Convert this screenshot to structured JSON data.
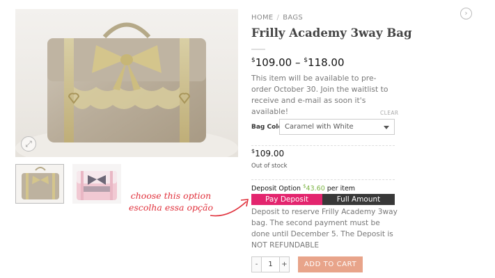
{
  "breadcrumb": {
    "home": "HOME",
    "separator": "/",
    "category": "BAGS"
  },
  "product": {
    "title": "Frilly Academy 3way Bag",
    "price_min": "109.00",
    "price_max": "118.00",
    "currency_symbol": "$",
    "price_dash": "–",
    "notice": "This item will be available to pre-order October 30. Join the waitlist to receive and e-mail as soon it's available!"
  },
  "variation": {
    "clear_label": "CLEAR",
    "color_label": "Bag Color",
    "color_value": "Caramel with White",
    "price": "109.00",
    "stock": "Out of stock"
  },
  "deposit": {
    "label": "Deposit Option",
    "amount": "43.60",
    "suffix": "per item",
    "pay_deposit_label": "Pay Deposit",
    "full_amount_label": "Full Amount",
    "description": "Deposit to reserve Frilly Academy 3way bag. The second payment must be done until December 5. The Deposit is NOT REFUNDABLE"
  },
  "annotation": {
    "line1": "choose this option",
    "line2": "escolha essa opção"
  },
  "cart": {
    "minus": "-",
    "quantity": "1",
    "plus": "+",
    "add_to_cart": "ADD TO CART"
  },
  "icons": {
    "zoom": "zoom-icon",
    "next": "chevron-right-icon"
  },
  "colors": {
    "pay_deposit": "#e3256e",
    "full_amount": "#383838",
    "add_to_cart": "#e8a48a",
    "deposit_amount": "#7bb342",
    "annotation": "#e0303b"
  }
}
